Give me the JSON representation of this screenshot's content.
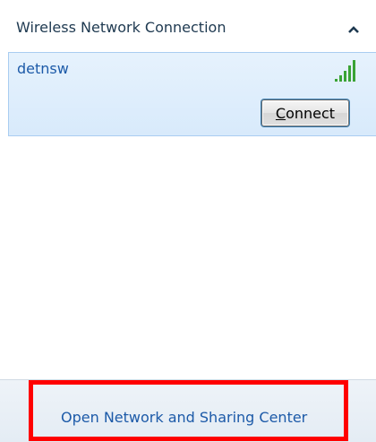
{
  "section": {
    "title": "Wireless Network Connection",
    "collapse_icon": "chevron-up-icon"
  },
  "networks": [
    {
      "name": "detnsw",
      "signal_icon": "signal-strength-icon",
      "signal_bars": 5,
      "signal_max_bars": 5,
      "connect_label_prefix": "",
      "connect_label_mnemonic": "C",
      "connect_label_rest": "onnect"
    }
  ],
  "footer": {
    "link_label": "Open Network and Sharing Center"
  },
  "annotation": {
    "highlight_color": "#ff0000"
  },
  "colors": {
    "link": "#1c5aa8",
    "header_text": "#1e3950",
    "selected_bg": "#e6f2fd",
    "selected_border": "#a9cdf1",
    "signal_green": "#3aa335"
  }
}
